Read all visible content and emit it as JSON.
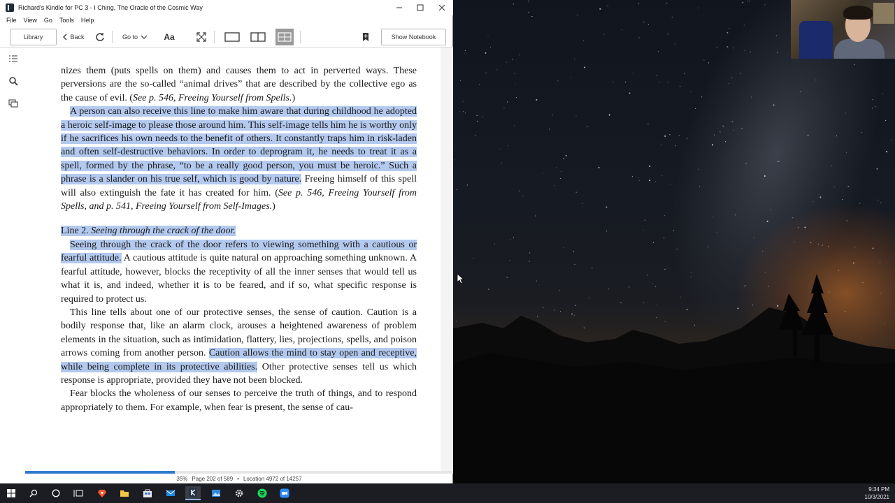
{
  "window": {
    "title": "Richard's Kindle for PC 3 - I Ching, The Oracle of the Cosmic Way"
  },
  "menu": [
    "File",
    "View",
    "Go",
    "Tools",
    "Help"
  ],
  "toolbar": {
    "library_label": "Library",
    "back_label": "Back",
    "goto_label": "Go to",
    "font_label": "Aa",
    "notebook_label": "Show Notebook"
  },
  "book": {
    "para1": [
      {
        "t": "nizes them (puts spells on them) and causes them to act in perverted ways. These perversions are the so-called “animal drives” that are described by the collective ego as the cause of evil. (",
        "h": false
      },
      {
        "t": "See p. 546, Freeing Yourself from Spells.",
        "h": false,
        "i": true
      },
      {
        "t": ")",
        "h": false
      }
    ],
    "para2": [
      {
        "t": "A person can also receive this line to make him aware that during childhood he adopted a heroic self-image to please those around him. This self-image tells him he is worthy only if he sacrifices his own needs to the benefit of others. It constantly traps him in risk-laden and often self-destructive behaviors. In order to deprogram it, he needs to treat it as a spell, formed by the phrase, “to be a really good person, you must be heroic.” Such a phrase is a slander on his true self, which is good by nature.",
        "h": true
      },
      {
        "t": " Freeing himself of this spell will also extinguish the fate it has created for him. (",
        "h": false
      },
      {
        "t": "See p. 546, Freeing Yourself from Spells, and p. 541, Freeing Yourself from Self-Images.",
        "h": false,
        "i": true
      },
      {
        "t": ")",
        "h": false
      }
    ],
    "line2_label": "Line 2.",
    "line2_title": "Seeing through the crack of the door.",
    "para3": [
      {
        "t": "Seeing through the crack of the door refers to viewing something with a cautious or fearful attitude.",
        "h": true
      },
      {
        "t": " A cautious attitude is quite natural on approaching something unknown. A fearful attitude, however, blocks the receptivity of all the inner senses that would tell us what it is, and indeed, whether it is to be feared, and if so, what specific response is required to protect us.",
        "h": false
      }
    ],
    "para4": [
      {
        "t": "This line tells about one of our protective senses, the sense of caution. Caution is a bodily response that, like an alarm clock, arouses a heightened awareness of problem elements in the situation, such as intimidation, flattery, lies, projections, spells, and poison arrows coming from another person. ",
        "h": false
      },
      {
        "t": "Caution allows the mind to stay open and receptive, while being complete in its protective abilities.",
        "h": true
      },
      {
        "t": " Other protective senses tell us which response is appropriate, provided they have not been blocked.",
        "h": false
      }
    ],
    "para5": [
      {
        "t": "Fear blocks the wholeness of our senses to perceive the truth of things, and to re­spond appropriately to them. For example, when fear is present, the sense of cau-",
        "h": false
      }
    ]
  },
  "status": {
    "percent_label": "35%",
    "progress": 0.35,
    "page_label": "Page 202 of 589",
    "location_label": "Location 4972 of 14257"
  },
  "clock": {
    "time": "9:34 PM",
    "date": "10/3/2021"
  },
  "colors": {
    "highlight": "#b3c9ee",
    "progress": "#2f7bd0"
  }
}
